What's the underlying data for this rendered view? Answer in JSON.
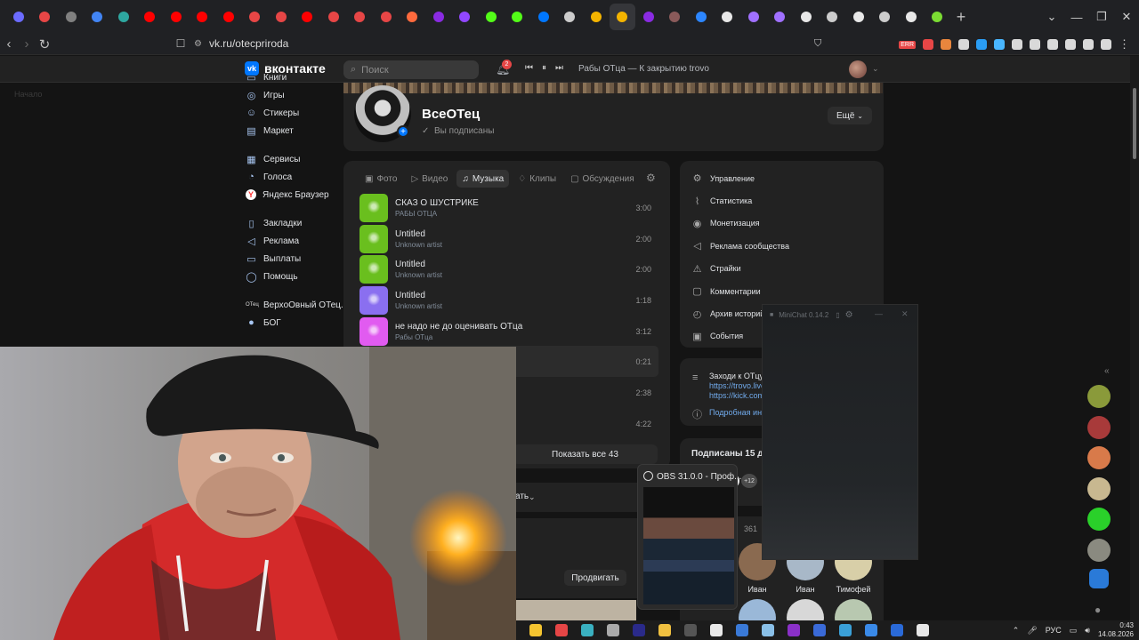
{
  "browser": {
    "url": "vk.ru/otecpriroda",
    "new_tab": "+",
    "error_badge": "ERR",
    "tab_colors": [
      "#6b6bff",
      "#e64646",
      "#808080",
      "#4285f4",
      "#2ea7a0",
      "#ff0000",
      "#ff0000",
      "#ff0000",
      "#ff0000",
      "#e64646",
      "#e64646",
      "#ff0000",
      "#e64646",
      "#e64646",
      "#e64646",
      "#ff6a3d",
      "#8a2be2",
      "#9147ff",
      "#53fc18",
      "#53fc18",
      "#0077ff",
      "#cccccc",
      "#f4b400",
      "#f4b400",
      "#8a2be2",
      "#8a5a5a",
      "#2c86ff",
      "#e8e8e8",
      "#a070ff",
      "#a070ff",
      "#e8e8e8",
      "#cccccc",
      "#e8e8e8",
      "#cccccc",
      "#e8e8e8",
      "#7bdc33"
    ],
    "ext_colors": [
      "#e64646",
      "#e8863d",
      "#d9d9d9",
      "#2a9df4",
      "#49b6ff",
      "#d9d9d9",
      "#d9d9d9",
      "#d9d9d9",
      "#d9d9d9",
      "#d9d9d9",
      "#d9d9d9"
    ]
  },
  "vk": {
    "brand": "вконтакте",
    "logo_mark": "vk",
    "search_placeholder": "Поиск",
    "notifications": "2",
    "now_playing": "Рабы ОТцa — К закрытию trovo",
    "ghost_text": "Начало"
  },
  "leftnav": [
    {
      "label": "Книги",
      "icon": "book-icon",
      "glyph": "▭"
    },
    {
      "label": "Игры",
      "icon": "gamepad-icon",
      "glyph": "◎"
    },
    {
      "label": "Стикеры",
      "icon": "sticker-icon",
      "glyph": "☺"
    },
    {
      "label": "Маркет",
      "icon": "shop-icon",
      "glyph": "▤"
    },
    {
      "label": "",
      "icon": "",
      "glyph": ""
    },
    {
      "label": "Сервисы",
      "icon": "services-icon",
      "glyph": "▦"
    },
    {
      "label": "Голоса",
      "icon": "votes-icon",
      "glyph": "◔"
    },
    {
      "label": "Яндекс Браузер",
      "icon": "yandex-icon",
      "glyph": "Y"
    },
    {
      "label": "",
      "icon": "",
      "glyph": ""
    },
    {
      "label": "Закладки",
      "icon": "bookmark-icon",
      "glyph": "▯"
    },
    {
      "label": "Реклама",
      "icon": "megaphone-icon",
      "glyph": "◁"
    },
    {
      "label": "Выплаты",
      "icon": "payments-icon",
      "glyph": "▭"
    },
    {
      "label": "Помощь",
      "icon": "help-icon",
      "glyph": "◯"
    },
    {
      "label": "",
      "icon": "",
      "glyph": ""
    },
    {
      "label": "ВерхоОвный ОТец...",
      "icon": "community-icon",
      "glyph": "ОТец"
    },
    {
      "label": "БОГ",
      "icon": "community-icon",
      "glyph": "●"
    }
  ],
  "group": {
    "name": "ВсеОТец",
    "status": "Вы подписаны",
    "more": "Ещё"
  },
  "music": {
    "tabs": [
      {
        "label": "Фото",
        "glyph": "▣"
      },
      {
        "label": "Видео",
        "glyph": "▷"
      },
      {
        "label": "Музыка",
        "glyph": "♫"
      },
      {
        "label": "Клипы",
        "glyph": "♢"
      },
      {
        "label": "Обсуждения",
        "glyph": "▢"
      }
    ],
    "active_tab": "Музыка",
    "songs": [
      {
        "title": "СКАЗ О ШУСТРИКЕ",
        "artist": "РАБЫ ОТЦА",
        "duration": "3:00",
        "cover": "#6abf1e"
      },
      {
        "title": "Untitled",
        "artist": "Unknown artist",
        "duration": "2:00",
        "cover": "#6abf1e"
      },
      {
        "title": "Untitled",
        "artist": "Unknown artist",
        "duration": "2:00",
        "cover": "#6abf1e"
      },
      {
        "title": "Untitled",
        "artist": "Unknown artist",
        "duration": "1:18",
        "cover": "#8a6ff0"
      },
      {
        "title": "не надо не до оценивать ОТца",
        "artist": "Рабы ОТца",
        "duration": "3:12",
        "cover": "#e15bf0"
      },
      {
        "title": "",
        "artist": "",
        "duration": "0:21",
        "cover": ""
      },
      {
        "title": "",
        "artist": "",
        "duration": "2:38",
        "cover": ""
      },
      {
        "title": "",
        "artist": "",
        "duration": "4:22",
        "cover": ""
      }
    ],
    "show_all": "Показать все 43",
    "promote": "Продвигать",
    "collapsed_suffix": "ать"
  },
  "admin": [
    {
      "label": "Управление",
      "glyph": "⚙"
    },
    {
      "label": "Статистика",
      "glyph": "⌇"
    },
    {
      "label": "Монетизация",
      "glyph": "◉"
    },
    {
      "label": "Реклама сообщества",
      "glyph": "◁"
    },
    {
      "label": "Страйки",
      "glyph": "⚠"
    },
    {
      "label": "Комментарии",
      "glyph": "▢"
    },
    {
      "label": "Архив историй",
      "glyph": "◴"
    },
    {
      "label": "События",
      "glyph": "▣"
    }
  ],
  "info": {
    "line1": "Заходи к ОТцу",
    "line2": "https://trovo.live",
    "line3": "https://kick.com",
    "line4": "Подробная информация"
  },
  "subscribers": {
    "title": "Подписаны 15 друзей",
    "more": "+12",
    "colors": [
      "#b0805a",
      "#8a8a70",
      "#e8e8e8"
    ]
  },
  "friends": {
    "count": "361",
    "items": [
      {
        "name": "Иван",
        "color": "#8a6a50"
      },
      {
        "name": "Иван",
        "color": "#a8b8c8"
      },
      {
        "name": "Тимофей",
        "color": "#d8cfa8"
      }
    ],
    "row2_colors": [
      "#9ab8d8",
      "#d8d8d8",
      "#b8c8b0"
    ]
  },
  "right_avatars": [
    "#8a9a3a",
    "#a83a3a",
    "#d87a4a",
    "#c8b890",
    "#2ad02a",
    "#8a8a80",
    "#2a7ad8"
  ],
  "minichat": {
    "title": "MiniChat 0.14.2"
  },
  "obs": {
    "title": "OBS 31.0.0 - Проф..."
  },
  "taskbar": {
    "icon_colors": [
      "#f4c430",
      "#e64646",
      "#3ab0c0",
      "#aaaaaa",
      "#2a2a8a",
      "#f0c040",
      "#555555",
      "#e8e8e8",
      "#3a7ad8",
      "#8ac0e8",
      "#8a30c8",
      "#3a6ad8",
      "#3aa0d8",
      "#3a8ae8",
      "#2a6ad8",
      "#e8e8e8"
    ],
    "lang": "РУС",
    "time": "0:43",
    "date": "14.08.2026"
  }
}
